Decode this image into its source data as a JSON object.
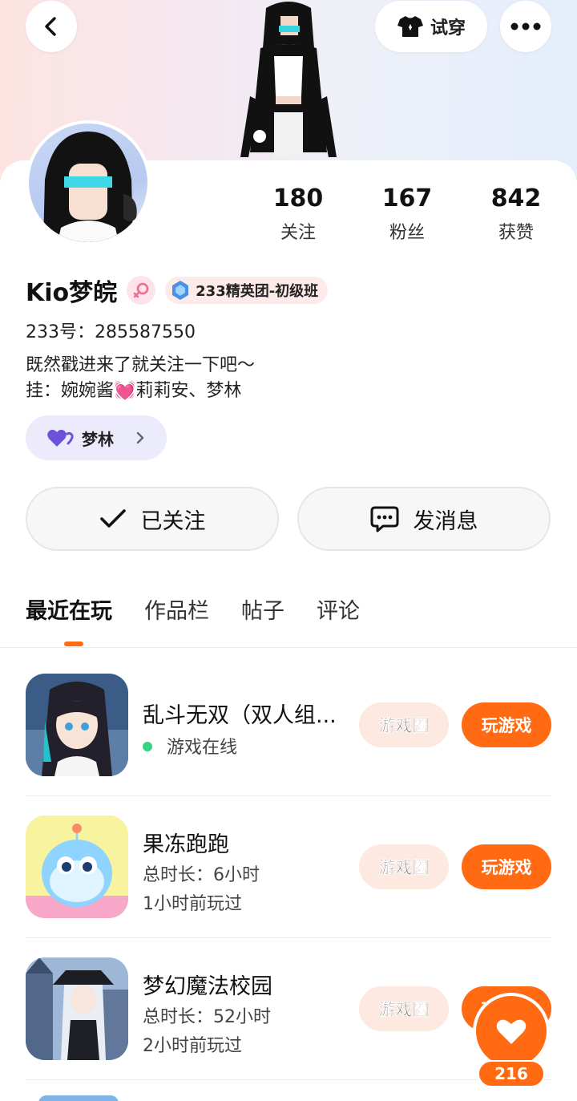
{
  "header": {
    "try_on_label": "试穿",
    "colors": {
      "accent": "#ff6a13"
    }
  },
  "stats": [
    {
      "value": "180",
      "label": "关注"
    },
    {
      "value": "167",
      "label": "粉丝"
    },
    {
      "value": "842",
      "label": "获赞"
    }
  ],
  "profile": {
    "name": "Kio梦皖",
    "gender_icon": "female-icon",
    "group_badge": "233精英团-初级班",
    "uid": "233号：285587550",
    "bio_line1": "既然戳进来了就关注一下吧～",
    "bio_line2": "挂：婉婉酱💓莉莉安、梦林",
    "cp_tag": "梦林"
  },
  "actions": {
    "followed_label": "已关注",
    "message_label": "发消息"
  },
  "tabs": [
    {
      "label": "最近在玩",
      "active": true
    },
    {
      "label": "作品栏",
      "active": false
    },
    {
      "label": "帖子",
      "active": false
    },
    {
      "label": "评论",
      "active": false
    }
  ],
  "games": [
    {
      "title": "乱斗无双（双人组...",
      "line1": "游戏在线",
      "line2": "",
      "online": true,
      "circle_label": "游戏圈",
      "play_label": "玩游戏"
    },
    {
      "title": "果冻跑跑",
      "line1": "总时长：6小时",
      "line2": "1小时前玩过",
      "online": false,
      "circle_label": "游戏圈",
      "play_label": "玩游戏"
    },
    {
      "title": "梦幻魔法校园",
      "line1": "总时长：52小时",
      "line2": "2小时前玩过",
      "online": false,
      "circle_label": "游戏圈",
      "play_label": "玩游戏"
    }
  ],
  "like": {
    "count": "216"
  }
}
